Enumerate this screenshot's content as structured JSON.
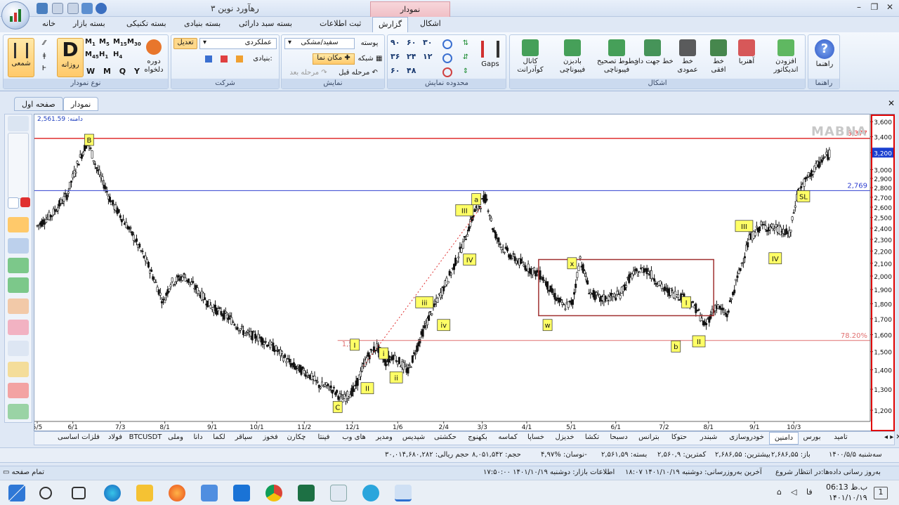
{
  "window": {
    "title": "رهآورد نوین ۳",
    "context_tab": "نمودار"
  },
  "ribbon_tabs": [
    "خانه",
    "بسته بازار",
    "بسته تکنیکی",
    "بسته بنیادی",
    "بسته سبد دارائی",
    "ثبت اطلاعات",
    "گزارش",
    "اشکال"
  ],
  "ribbon": {
    "chart_type": {
      "title": "نوع نمودار",
      "candle_label": "شمعی",
      "period_letter": "D",
      "period_label": "روزانه",
      "intervals": [
        [
          "M",
          "1"
        ],
        [
          "M",
          "5"
        ],
        [
          "M",
          "15"
        ],
        [
          "M",
          "30"
        ],
        [
          "M",
          "45"
        ],
        [
          "H",
          "1"
        ],
        [
          "H",
          "4"
        ]
      ],
      "period_letters": [
        "W",
        "M",
        "Q",
        "Y"
      ],
      "custom_label": "دوره\nدلخواه"
    },
    "company": {
      "title": "شرکت",
      "adjust_label": "تعدیل",
      "dropdown_value": "عملکردی",
      "fundamental_label": "بنیادی:"
    },
    "display": {
      "title": "نمایش",
      "skin_label": "پوسته",
      "skin_value": "سفید/مشکی",
      "grid_label": "شبکه",
      "cursor_label": "مکان نما",
      "prev_label": "مرحله قبل",
      "next_label": "مرحله بعد"
    },
    "range": {
      "title": "محدوده نمایش",
      "values": [
        "۹۰",
        "۶۰",
        "۳۰",
        "۳۶",
        "۲۴",
        "۱۲",
        "۶۰",
        "۴۸"
      ],
      "gaps_label": "Gaps"
    },
    "shapes": {
      "title": "اشکال",
      "items": [
        "افزودن\nاندیکاتور",
        "آهنربا",
        "خط\nافقی",
        "خط\nعمودی",
        "خط جهت دار",
        "خطوط تصحیح\nفیبوناچی",
        "بادبزن\nفیبوناچی",
        "کانال\nکوآدرانت"
      ]
    },
    "help": {
      "title": "راهنما",
      "label": "راهنما"
    }
  },
  "doc_tabs": [
    "صفحه اول",
    "نمودار"
  ],
  "chart": {
    "watermark": "MABNA",
    "corner_label": "دامنه: 2,561.59",
    "y_ticks": [
      "3,600",
      "3,400",
      "3,200",
      "3,000",
      "2,900",
      "2,800",
      "2,700",
      "2,600",
      "2,500",
      "2,400",
      "2,300",
      "2,200",
      "2,100",
      "2,000",
      "1,900",
      "1,800",
      "1,700",
      "1,600",
      "1,500",
      "1,400",
      "1,300",
      "1,200"
    ],
    "current_price": "3,200",
    "x_ticks": [
      "5/5",
      "6/1",
      "7/3",
      "8/1",
      "9/1",
      "10/1",
      "11/2",
      "12/1",
      "1/6",
      "2/4",
      "3/3",
      "4/1",
      "5/1",
      "6/1",
      "7/2",
      "8/1",
      "9/1",
      "10/3"
    ],
    "levels": [
      {
        "label": "3,377",
        "color": "#e03030"
      },
      {
        "label": "2,769",
        "color": "#3040d0"
      },
      {
        "label": "78.20%",
        "color": "#e07070"
      }
    ],
    "fib_left_label": "1,5",
    "wave_labels": [
      "B",
      "C",
      "I",
      "II",
      "i",
      "ii",
      "iii",
      "iv",
      "III",
      "IV",
      "a",
      "x",
      "w",
      "b",
      "I",
      "II",
      "III",
      "IV",
      "SL"
    ],
    "colors": {
      "level_red": "#e03030",
      "level_blue": "#3040d0",
      "box": "#a03030",
      "candles": "#111111"
    }
  },
  "symbol_tabs": [
    "تامید",
    "بورس",
    "دامنین",
    "خودروسازی",
    "شبندر",
    "حتوکا",
    "بترانس",
    "دسبحا",
    "تکشا",
    "خدیزل",
    "خساپا",
    "کماسه",
    "بکهنوج",
    "حکشتی",
    "شپدیس",
    "ومدیر",
    "های وب",
    "فپنتا",
    "چکارن",
    "فخوز",
    "سپاقر",
    "لکما",
    "دانا",
    "وملی",
    "BTCUSDT",
    "فولاد",
    "فلزات اساسی"
  ],
  "info_bar": {
    "date": "سه‌شنبه ۱۴۰۰/۵/۵",
    "open": "باز: ۲,۶۸۶,۵۵",
    "high": "بیشترین: ۲,۶۸۶,۵۵",
    "low": "کمترین: ۲,۵۶۰,۹",
    "close": "بسته: ۲,۵۶۱,۵۹",
    "change": "نوسان: %۴,۹۷-",
    "volume": "حجم: ۸,۰۵۱,۵۴۲",
    "value": "حجم ریالی: ۳۰,۰۱۴,۶۸۰,۲۸۲"
  },
  "status_bar": {
    "left": "تمام صفحه",
    "update_status": "به‌روز رسانی داده‌ها:در انتظار شروع",
    "last_update": "آخرین به‌روزرسانی: دوشنبه ۱۴۰۱/۱۰/۱۹  ۱۸:۰۷",
    "market_info": "اطلاعات بازار: دوشنبه ۱۴۰۱/۱۰/۱۹  ۱۷:۵۰:۰۰"
  },
  "taskbar": {
    "time": "ب.ظ 06:13",
    "date": "۱۴۰۱/۱۰/۱۹",
    "lang": "فا",
    "notification_count": "1"
  }
}
